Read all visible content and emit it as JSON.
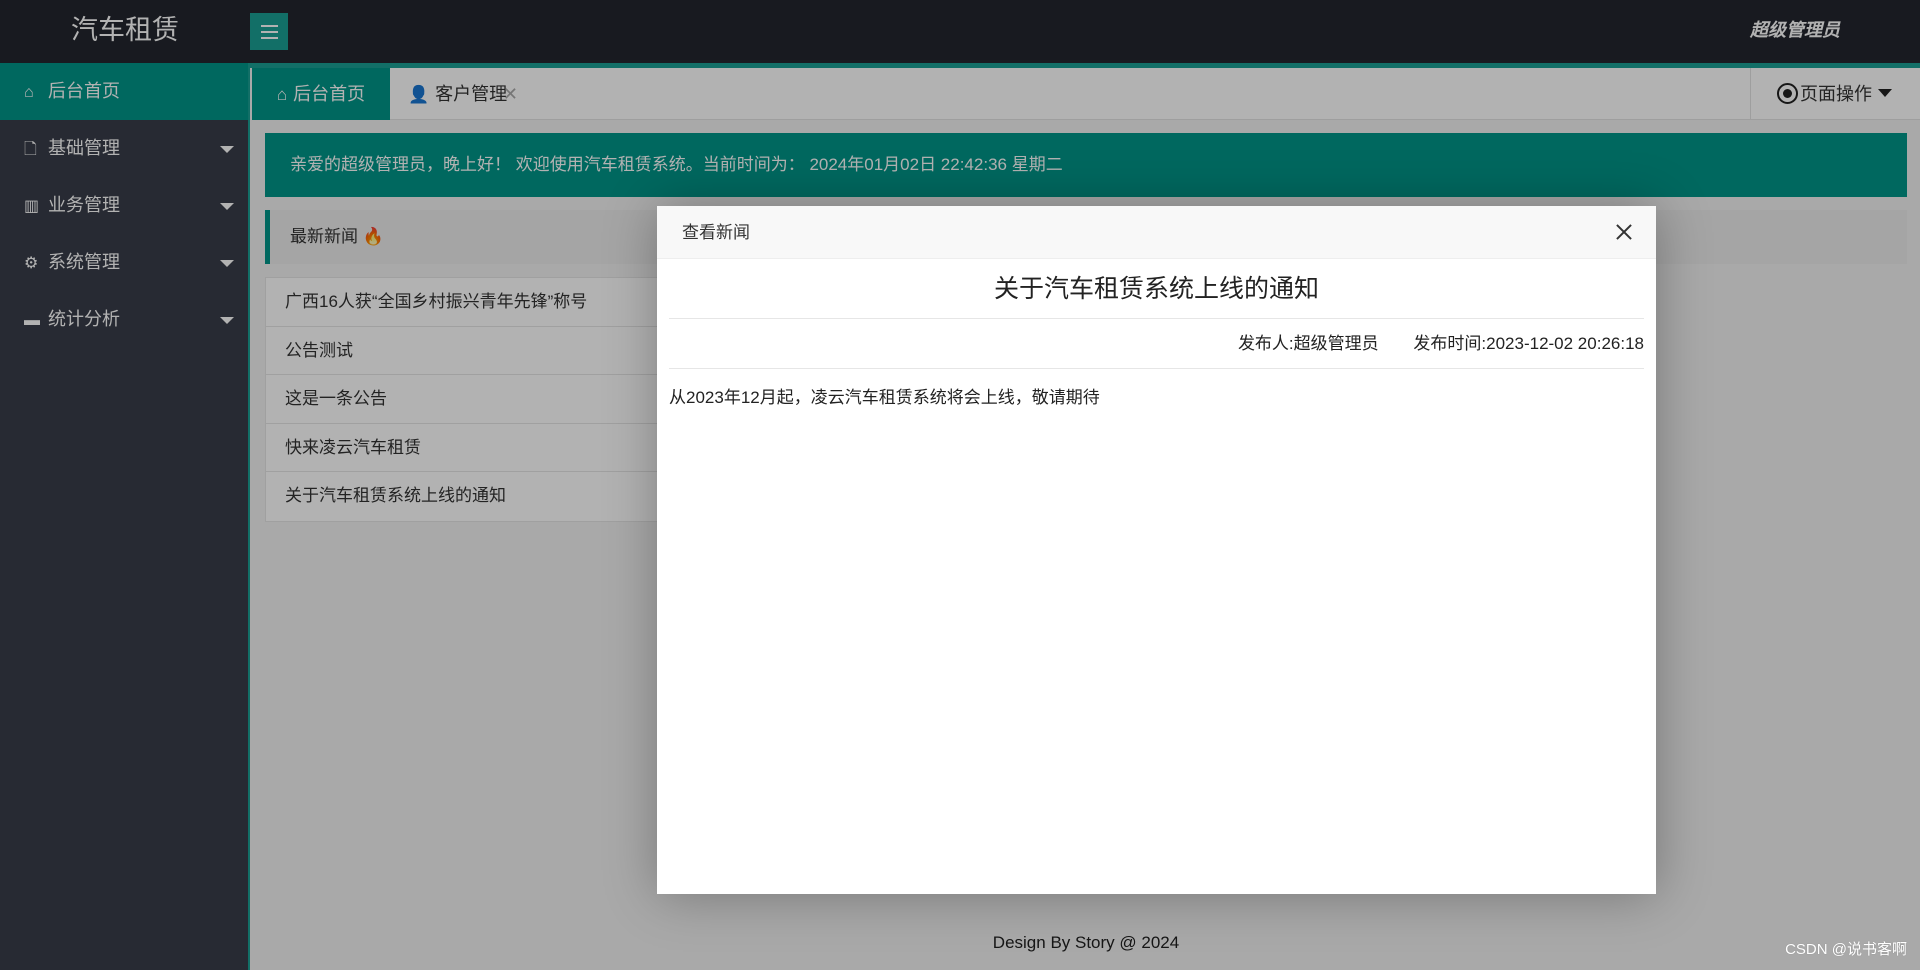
{
  "header": {
    "app_title": "汽车租赁",
    "user_name": "超级管理员"
  },
  "sidebar": {
    "items": [
      {
        "label": "后台首页",
        "icon": "home-icon"
      },
      {
        "label": "基础管理",
        "icon": "file-icon"
      },
      {
        "label": "业务管理",
        "icon": "book-icon"
      },
      {
        "label": "系统管理",
        "icon": "gear-icon"
      },
      {
        "label": "统计分析",
        "icon": "monitor-icon"
      }
    ]
  },
  "tabs": {
    "home_label": "后台首页",
    "customer_label": "客户管理",
    "page_ops_label": "页面操作"
  },
  "content": {
    "welcome_text": "亲爱的超级管理员，晚上好！ 欢迎使用汽车租赁系统。当前时间为： 2024年01月02日 22:42:36 星期二",
    "news_header": "最新新闻",
    "news_list": [
      "广西16人获“全国乡村振兴青年先锋”称号",
      "公告测试",
      "这是一条公告",
      "快来凌云汽车租赁",
      "关于汽车租赁系统上线的通知"
    ]
  },
  "modal": {
    "title": "查看新闻",
    "news_title": "关于汽车租赁系统上线的通知",
    "publisher": "发布人:超级管理员",
    "publish_time": "发布时间:2023-12-02 20:26:18",
    "body": "从2023年12月起，凌云汽车租赁系统将会上线，敬请期待"
  },
  "footer": {
    "text": "Design By Story @ 2024",
    "watermark": "CSDN @说书客啊"
  },
  "colors": {
    "header_bg": "#23262e",
    "sidebar_bg": "#393d49",
    "accent": "#009688",
    "toggle_bg": "#1aa094"
  }
}
